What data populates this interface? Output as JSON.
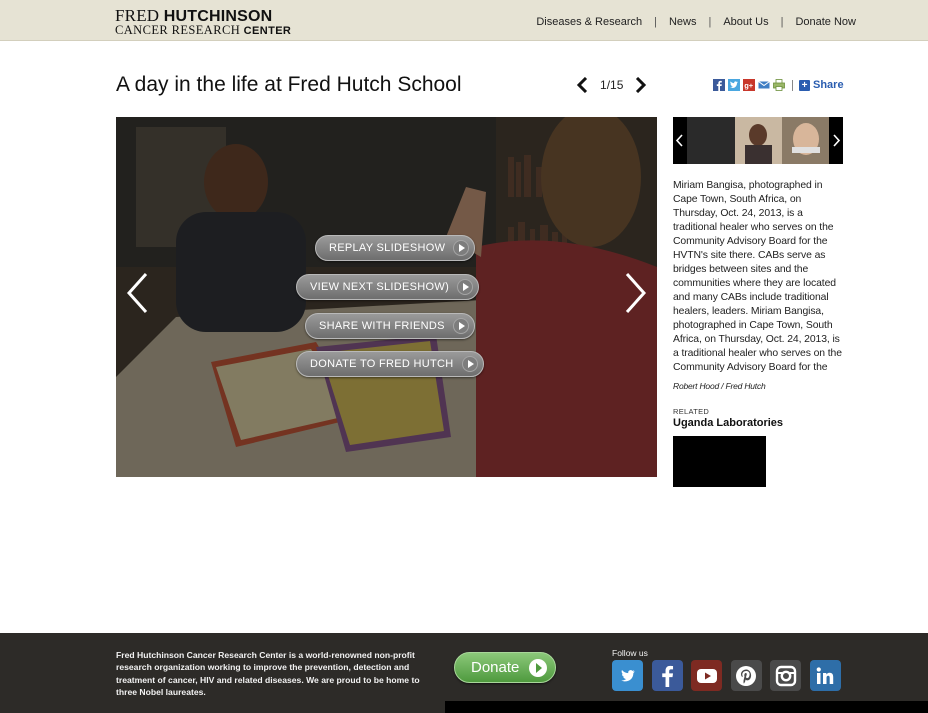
{
  "header": {
    "logo": {
      "line1_regular": "FRED ",
      "line1_bold": "HUTCHINSON",
      "line2_regular": "CANCER RESEARCH ",
      "line2_bold": "CENTER"
    },
    "nav": [
      {
        "label": "Diseases & Research"
      },
      {
        "label": "News"
      },
      {
        "label": "About Us"
      },
      {
        "label": "Donate Now"
      }
    ],
    "separator": "|"
  },
  "page": {
    "title": "A day in the life at Fred Hutch School",
    "pager": {
      "current": "1",
      "separator": "/",
      "total": "15"
    },
    "share_label": "Share",
    "share_icons": [
      "facebook-icon",
      "twitter-icon",
      "google-plus-icon",
      "email-icon",
      "print-icon"
    ]
  },
  "slideshow": {
    "buttons": [
      {
        "label": "REPLAY SLIDESHOW"
      },
      {
        "label": "VIEW NEXT SLIDESHOW)"
      },
      {
        "label": "SHARE WITH FRIENDS"
      },
      {
        "label": "DONATE TO FRED HUTCH"
      }
    ]
  },
  "sidebar": {
    "caption": "Miriam Bangisa, photographed in Cape Town, South Africa, on Thursday, Oct. 24, 2013, is a traditional healer who serves on the Community Advisory Board for the HVTN's site there. CABs serve as bridges between sites and the communities where they are located and many CABs include traditional healers, leaders. Miriam Bangisa, photographed in Cape Town, South Africa, on Thursday, Oct. 24, 2013, is a traditional healer who serves on the Community Advisory Board for the",
    "credit": "Robert Hood / Fred Hutch",
    "related_label": "RELATED",
    "related_title": "Uganda Laboratories"
  },
  "footer": {
    "about": "Fred Hutchinson Cancer Research Center is a world-renowned non-profit research organization working to improve the prevention, detection and treatment of cancer, HIV and related diseases. We are proud to be home to three Nobel laureates.",
    "donate_label": "Donate",
    "follow_label": "Follow us",
    "socials": [
      {
        "icon": "twitter-icon",
        "color": "#3a8fd0"
      },
      {
        "icon": "facebook-icon",
        "color": "#3b5a9a"
      },
      {
        "icon": "youtube-icon",
        "color": "#7e2a22"
      },
      {
        "icon": "pinterest-icon",
        "color": "#4a4a4a"
      },
      {
        "icon": "instagram-icon",
        "color": "#4a4a4a"
      },
      {
        "icon": "linkedin-icon",
        "color": "#2e6ea8"
      }
    ]
  },
  "colors": {
    "header_bg": "#e6e3d4",
    "footer_bg": "#2d2b28",
    "share_blue": "#2a5db0",
    "donate_green": "#5aa648"
  }
}
